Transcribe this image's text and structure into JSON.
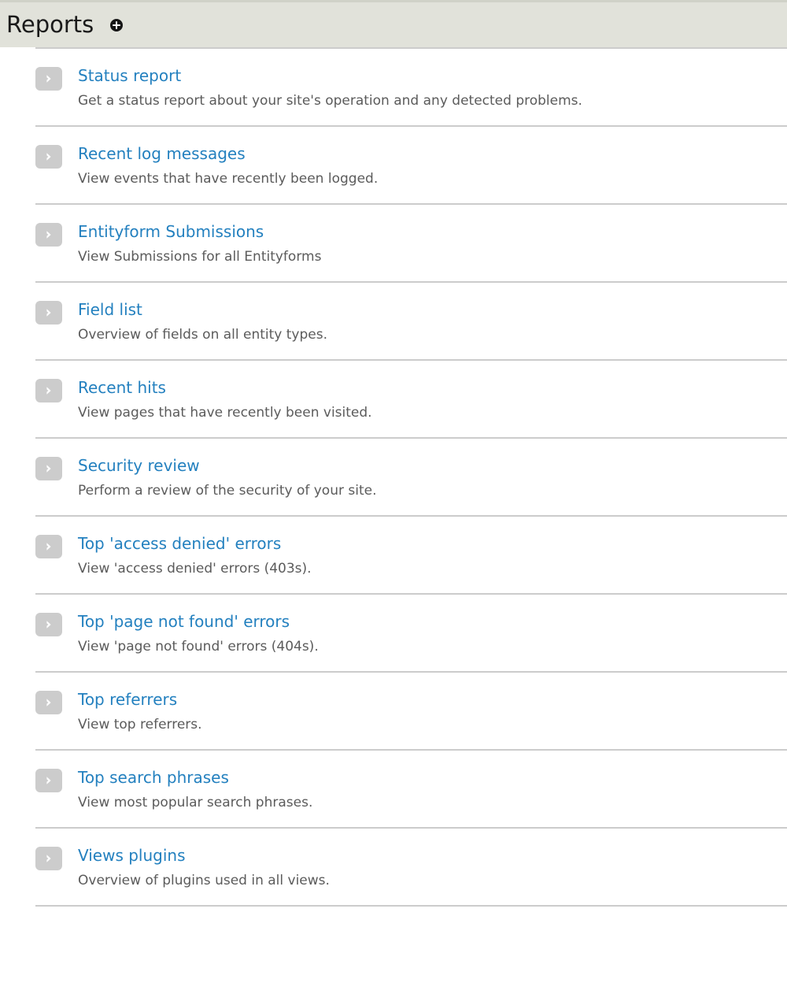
{
  "header": {
    "title": "Reports",
    "action_icon": "circle-plus-icon",
    "background_color": "#e1e2da",
    "title_color": "#1a1a1a"
  },
  "theme": {
    "link_color": "#2380bf",
    "description_color": "#5b5b5b",
    "divider_color": "#cccccc",
    "icon_chip_color": "#cccccc",
    "page_background": "#ffffff"
  },
  "reports": {
    "item_icon": "chevron-right-icon",
    "items": [
      {
        "title": "Status report",
        "description": "Get a status report about your site's operation and any detected problems."
      },
      {
        "title": "Recent log messages",
        "description": "View events that have recently been logged."
      },
      {
        "title": "Entityform Submissions",
        "description": "View Submissions for all Entityforms"
      },
      {
        "title": "Field list",
        "description": "Overview of fields on all entity types."
      },
      {
        "title": "Recent hits",
        "description": "View pages that have recently been visited."
      },
      {
        "title": "Security review",
        "description": "Perform a review of the security of your site."
      },
      {
        "title": "Top 'access denied' errors",
        "description": "View 'access denied' errors (403s)."
      },
      {
        "title": "Top 'page not found' errors",
        "description": "View 'page not found' errors (404s)."
      },
      {
        "title": "Top referrers",
        "description": "View top referrers."
      },
      {
        "title": "Top search phrases",
        "description": "View most popular search phrases."
      },
      {
        "title": "Views plugins",
        "description": "Overview of plugins used in all views."
      }
    ]
  }
}
